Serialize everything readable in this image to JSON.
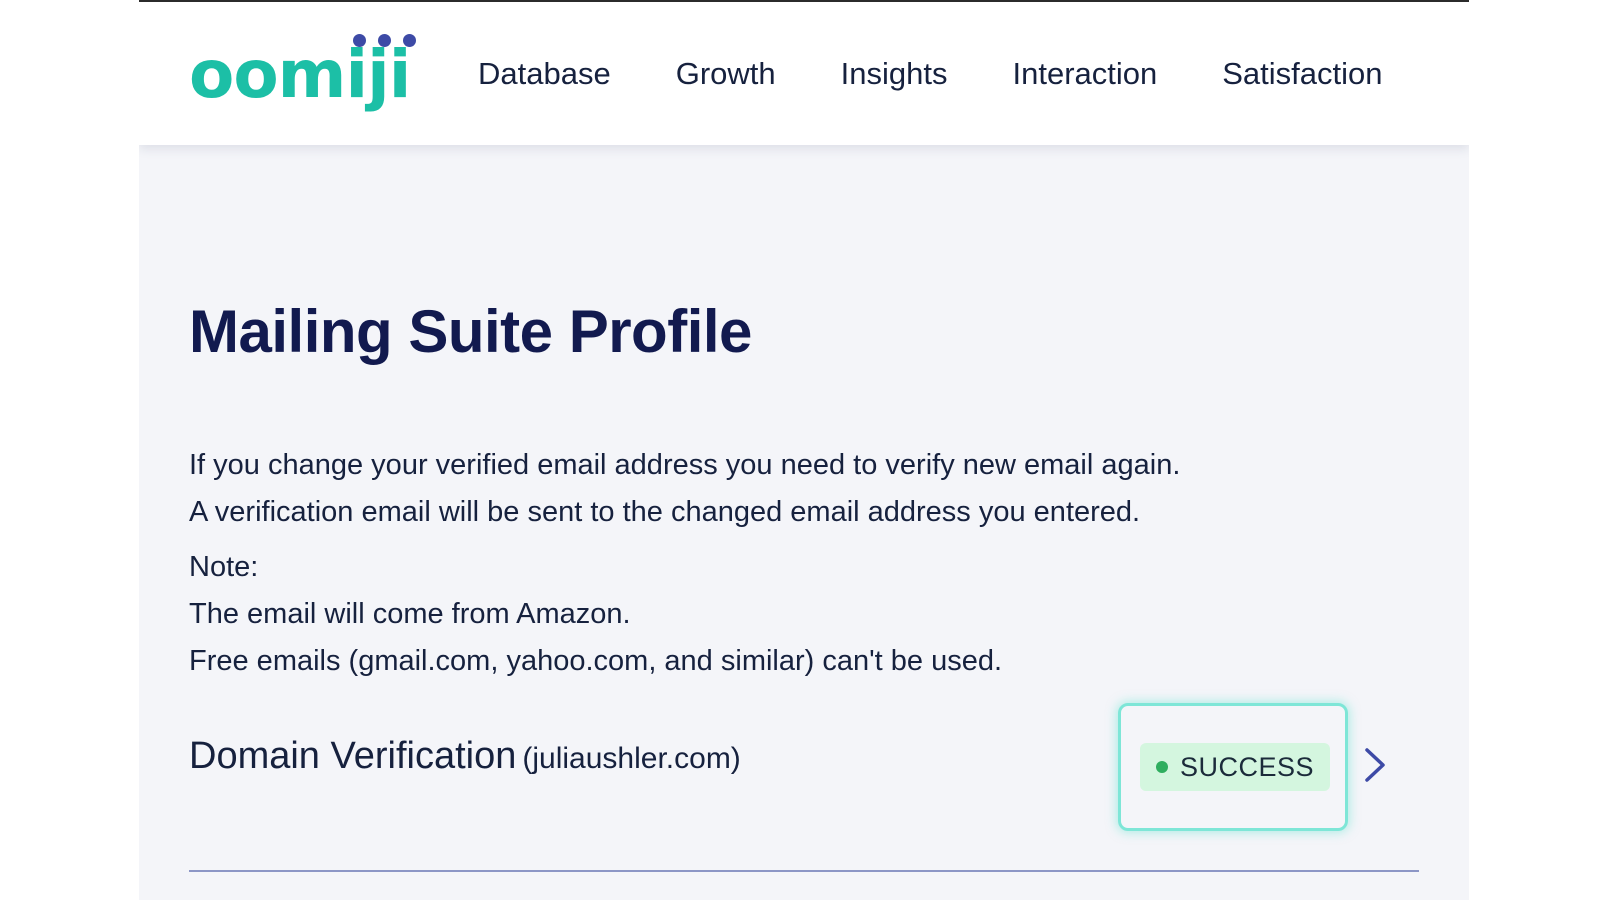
{
  "brand": {
    "logo_text": "oomiji",
    "logo_color": "#1cbfa6",
    "dot_color": "#3d4aa6"
  },
  "nav": {
    "items": [
      {
        "label": "Database"
      },
      {
        "label": "Growth"
      },
      {
        "label": "Insights"
      },
      {
        "label": "Interaction"
      },
      {
        "label": "Satisfaction"
      }
    ]
  },
  "page": {
    "title": "Mailing Suite Profile",
    "title_color": "#121a4f",
    "info_lines": [
      "If you change your verified email address you need to verify new email again.",
      "A verification email will be sent to the changed email address you entered."
    ],
    "note_label": "Note:",
    "note_lines": [
      "The email will come from Amazon.",
      "Free emails (gmail.com, yahoo.com, and similar) can't be used."
    ]
  },
  "domain_verification": {
    "label": "Domain Verification",
    "domain": "(juliaushler.com)",
    "status": "SUCCESS",
    "status_dot_color": "#2fae5f",
    "status_bg_color": "#d4f6df",
    "chevron_icon": "chevron-right-icon",
    "chevron_color": "#3d4aa6",
    "divider_color": "#8c96c6"
  }
}
